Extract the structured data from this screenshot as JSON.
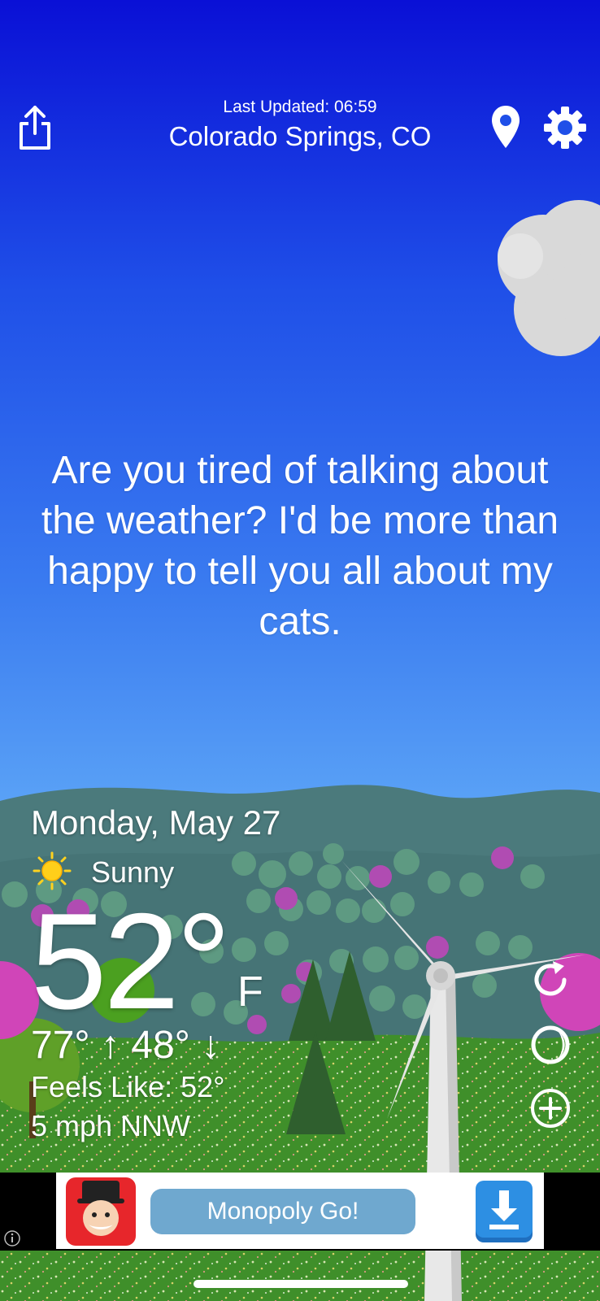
{
  "header": {
    "last_updated": "Last Updated: 06:59",
    "location": "Colorado Springs, CO"
  },
  "quip": "Are you tired of talking about the weather? I'd be more than happy to tell you all about my cats.",
  "current": {
    "date": "Monday, May 27",
    "condition": "Sunny",
    "temperature": "52°",
    "unit": "F",
    "high_low": "77° ↑  48° ↓",
    "feels_like": "Feels Like: 52°",
    "wind": "5 mph NNW"
  },
  "ad": {
    "title": "Monopoly Go!"
  },
  "icons": {
    "share": "share-icon",
    "location": "location-pin-icon",
    "settings": "gear-icon",
    "condition": "sun-icon",
    "refresh": "refresh-icon",
    "moon": "moon-phase-icon",
    "add": "add-location-icon",
    "ad_download": "download-icon",
    "ad_info": "info-icon"
  },
  "colors": {
    "sky_top": "#0a10d6",
    "sky_bottom": "#6ab4f8",
    "hills_far": "#4a7a7c",
    "grass": "#3f8f2a",
    "ad_bubble": "#6fa8cf",
    "ad_download": "#2d8fe3"
  }
}
